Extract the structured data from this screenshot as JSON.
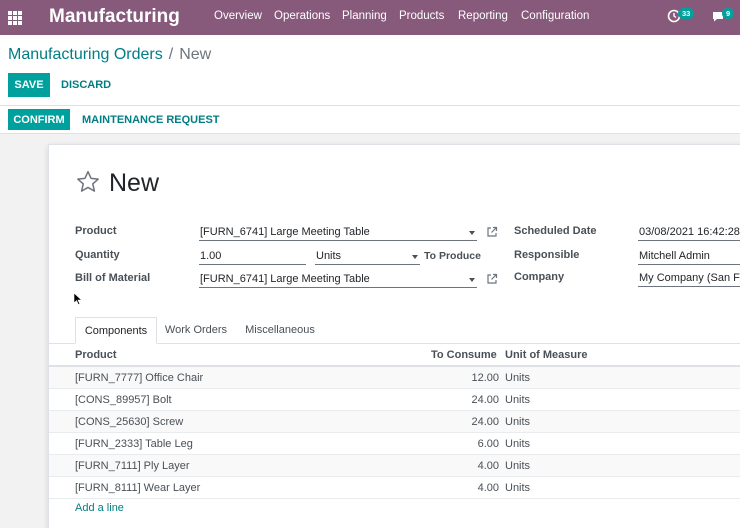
{
  "navbar": {
    "brand": "Manufacturing",
    "menus": [
      "Overview",
      "Operations",
      "Planning",
      "Products",
      "Reporting",
      "Configuration"
    ],
    "activity_count": "33",
    "message_count": "9",
    "color": "#875a7b"
  },
  "breadcrumb": {
    "parent": "Manufacturing Orders",
    "separator": "/",
    "current": "New"
  },
  "toolbar": {
    "save_label": "SAVE",
    "discard_label": "DISCARD"
  },
  "statusbar": {
    "confirm_label": "CONFIRM",
    "maintenance_label": "MAINTENANCE REQUEST"
  },
  "form": {
    "title": "New",
    "product_label": "Product",
    "product_value": "[FURN_6741] Large Meeting Table",
    "quantity_label": "Quantity",
    "quantity_value": "1.00",
    "uom_value": "Units",
    "to_produce_label": "To Produce",
    "bom_label": "Bill of Material",
    "bom_value": "[FURN_6741] Large Meeting Table",
    "scheduled_date_label": "Scheduled Date",
    "scheduled_date_value": "03/08/2021 16:42:28",
    "responsible_label": "Responsible",
    "responsible_value": "Mitchell Admin",
    "company_label": "Company",
    "company_value": "My Company (San Fra"
  },
  "tabs": [
    "Components",
    "Work Orders",
    "Miscellaneous"
  ],
  "table": {
    "headers": {
      "product": "Product",
      "to_consume": "To Consume",
      "uom": "Unit of Measure"
    },
    "rows": [
      {
        "product": "[FURN_7777] Office Chair",
        "qty": "12.00",
        "uom": "Units"
      },
      {
        "product": "[CONS_89957] Bolt",
        "qty": "24.00",
        "uom": "Units"
      },
      {
        "product": "[CONS_25630] Screw",
        "qty": "24.00",
        "uom": "Units"
      },
      {
        "product": "[FURN_2333] Table Leg",
        "qty": "6.00",
        "uom": "Units"
      },
      {
        "product": "[FURN_7111] Ply Layer",
        "qty": "4.00",
        "uom": "Units"
      },
      {
        "product": "[FURN_8111] Wear Layer",
        "qty": "4.00",
        "uom": "Units"
      }
    ],
    "add_line": "Add a line"
  },
  "icons": {
    "apps": "apps-grid-icon",
    "activity": "clock-icon",
    "messages": "chat-icon",
    "favorite": "star-icon",
    "external": "external-link-icon",
    "dropdown": "caret-down-icon"
  }
}
